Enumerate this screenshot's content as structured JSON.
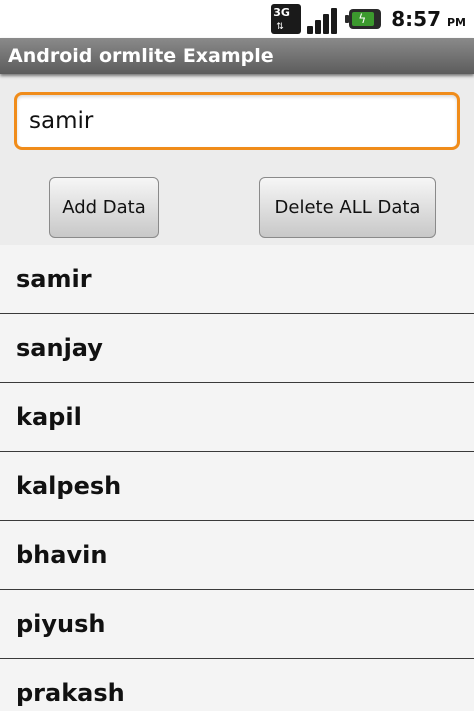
{
  "status_bar": {
    "network_label": "3G",
    "time": "8:57",
    "ampm": "PM",
    "icons": [
      "network-3g-icon",
      "signal-icon",
      "battery-charging-icon"
    ]
  },
  "app": {
    "title": "Android ormlite Example"
  },
  "input": {
    "value": "samir",
    "accent_color": "#f08c1a"
  },
  "buttons": {
    "add_label": "Add Data",
    "delete_label": "Delete ALL Data"
  },
  "list": {
    "items": [
      "samir",
      "sanjay",
      "kapil",
      "kalpesh",
      "bhavin",
      "piyush",
      "prakash"
    ]
  }
}
